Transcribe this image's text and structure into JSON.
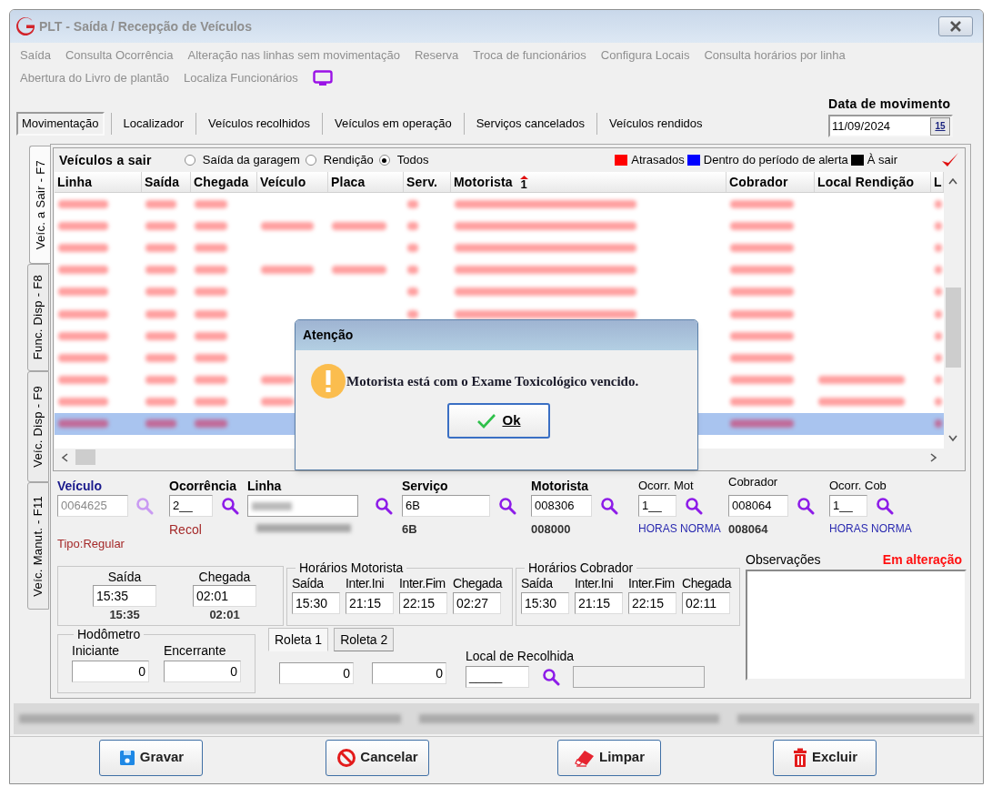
{
  "window": {
    "title": "PLT - Saída / Recepção de Veículos"
  },
  "menu": [
    [
      {
        "label": "Saída",
        "disabled": true
      },
      {
        "label": "Consulta Ocorrência",
        "disabled": true
      },
      {
        "label": "Alteração nas linhas sem movimentação",
        "disabled": true
      },
      {
        "label": "Reserva",
        "disabled": true
      },
      {
        "label": "Troca de funcionários",
        "disabled": true
      },
      {
        "label": "Configura Locais",
        "disabled": true
      },
      {
        "label": "Consulta horários por linha",
        "disabled": true
      }
    ],
    [
      {
        "label": "Abertura do Livro de plantão",
        "disabled": true
      },
      {
        "label": "Localiza Funcionários",
        "disabled": true
      }
    ]
  ],
  "tabs": [
    {
      "label": "Movimentação",
      "selected": true
    },
    {
      "label": "Localizador",
      "selected": false
    },
    {
      "label": "Veículos recolhidos",
      "selected": false
    },
    {
      "label": "Veículos em operação",
      "selected": false
    },
    {
      "label": "Serviços cancelados",
      "selected": false
    },
    {
      "label": "Veículos rendidos",
      "selected": false
    }
  ],
  "date": {
    "label": "Data de movimento",
    "value": "11/09/2024",
    "button": "15"
  },
  "side_tabs": [
    {
      "label": "Veíc. a Sair - F7",
      "selected": true
    },
    {
      "label": "Func. Disp - F8",
      "selected": false
    },
    {
      "label": "Veíc. Disp - F9",
      "selected": false
    },
    {
      "label": "Veíc. Manut. - F11",
      "selected": false
    }
  ],
  "grid": {
    "title": "Veículos a sair",
    "filters": [
      {
        "label": "Saída da garagem",
        "selected": false
      },
      {
        "label": "Rendição",
        "selected": false
      },
      {
        "label": "Todos",
        "selected": true
      }
    ],
    "legend": [
      {
        "label": "Atrasados",
        "color": "#ff0000"
      },
      {
        "label": "Dentro do período de alerta",
        "color": "#0000ff"
      },
      {
        "label": "À sair",
        "color": "#000000"
      }
    ],
    "columns": [
      {
        "label": "Linha"
      },
      {
        "label": "Saída"
      },
      {
        "label": "Chegada"
      },
      {
        "label": "Veículo"
      },
      {
        "label": "Placa"
      },
      {
        "label": "Serv."
      },
      {
        "label": "Motorista",
        "sort": "1"
      },
      {
        "label": "Cobrador"
      },
      {
        "label": "Local Rendição"
      },
      {
        "label": "L"
      }
    ],
    "rows": [
      {
        "selected": false
      },
      {
        "selected": false
      },
      {
        "selected": false
      },
      {
        "selected": false
      },
      {
        "selected": false
      },
      {
        "selected": false
      },
      {
        "selected": false
      },
      {
        "selected": false
      },
      {
        "selected": false
      },
      {
        "selected": false
      },
      {
        "selected": true
      }
    ]
  },
  "dialog": {
    "title": "Atenção",
    "message": "Motorista está com o Exame Toxicológico vencido.",
    "button": "Ok"
  },
  "form": {
    "vehicle": {
      "label": "Veículo",
      "value": "0064625",
      "disabled": true,
      "note": "Tipo:Regular"
    },
    "occurrence": {
      "label": "Ocorrência",
      "value": "2__",
      "note": "Recol"
    },
    "line": {
      "label": "Linha"
    },
    "service": {
      "label": "Serviço",
      "value": "6B",
      "note": "6B"
    },
    "driver": {
      "label": "Motorista",
      "value": "008306",
      "note": "008000"
    },
    "driver_occurrence": {
      "label": "Ocorr. Mot",
      "value": "1__",
      "note": "HORAS NORMA"
    },
    "collector": {
      "label": "Cobrador",
      "value": "008064",
      "note": "008064"
    },
    "collector_occurrence": {
      "label": "Ocorr. Cob",
      "value": "1__",
      "note": "HORAS NORMA"
    },
    "vehicle_times": [
      {
        "label": "Saída",
        "value": "15:35",
        "note": "15:35"
      },
      {
        "label": "Chegada",
        "value": "02:01",
        "note": "02:01"
      }
    ],
    "driver_times": {
      "title": "Horários Motorista",
      "fields": [
        {
          "label": "Saída",
          "value": "15:30"
        },
        {
          "label": "Inter.Ini",
          "value": "21:15"
        },
        {
          "label": "Inter.Fim",
          "value": "22:15"
        },
        {
          "label": "Chegada",
          "value": "02:27"
        }
      ]
    },
    "collector_times": {
      "title": "Horários Cobrador",
      "fields": [
        {
          "label": "Saída",
          "value": "15:30"
        },
        {
          "label": "Inter.Ini",
          "value": "21:15"
        },
        {
          "label": "Inter.Fim",
          "value": "22:15"
        },
        {
          "label": "Chegada",
          "value": "02:11"
        }
      ]
    },
    "notes": {
      "label": "Observações",
      "status": "Em alteração"
    },
    "odometer": {
      "title": "Hodômetro",
      "fields": [
        {
          "label": "Iniciante",
          "value": "0"
        },
        {
          "label": "Encerrante",
          "value": "0"
        }
      ]
    },
    "turnstiles": {
      "tabs": [
        {
          "label": "Roleta 1",
          "selected": true
        },
        {
          "label": "Roleta 2",
          "selected": false
        }
      ],
      "values": [
        "0",
        "0"
      ]
    },
    "garage": {
      "label": "Local de Recolhida",
      "value": "_____"
    }
  },
  "buttons": [
    {
      "label": "Gravar",
      "kind": "save"
    },
    {
      "label": "Cancelar",
      "kind": "cancel"
    },
    {
      "label": "Limpar",
      "kind": "clear"
    },
    {
      "label": "Excluir",
      "kind": "delete"
    }
  ]
}
